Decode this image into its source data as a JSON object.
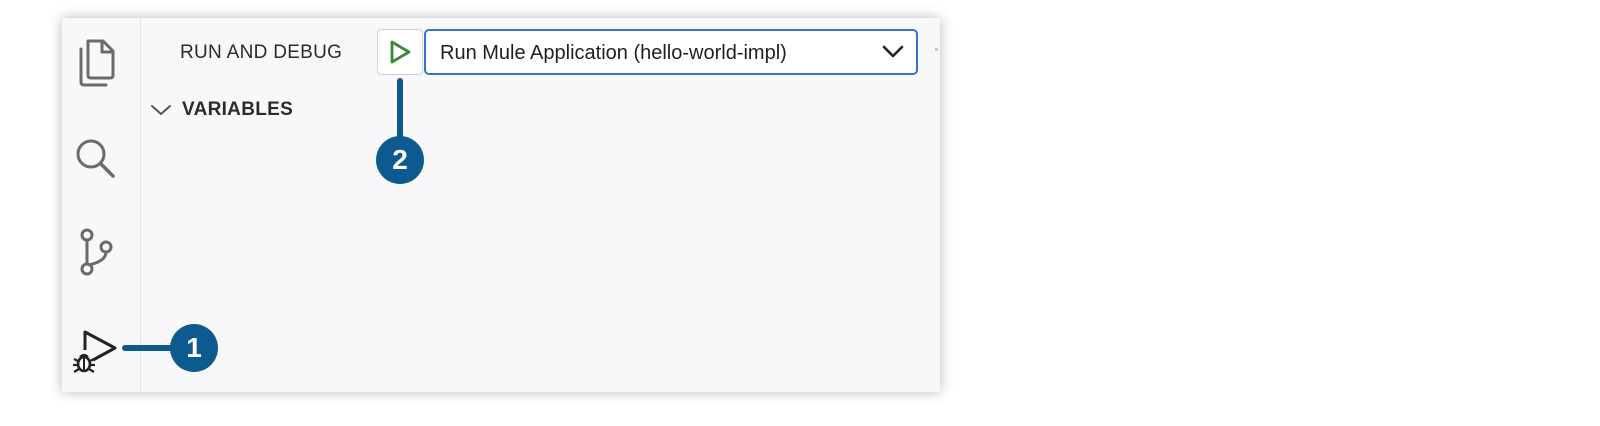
{
  "panel": {
    "title": "RUN AND DEBUG",
    "run_config": "Run Mule Application (hello-world-impl)",
    "section": "VARIABLES"
  },
  "activity_bar": {
    "items": [
      "explorer-icon",
      "search-icon",
      "source-control-icon",
      "run-and-debug-icon"
    ]
  },
  "callouts": {
    "one": "1",
    "two": "2"
  },
  "colors": {
    "callout": "#0d5a8f",
    "play": "#3a8a3a",
    "select_border": "#3b73c4"
  }
}
